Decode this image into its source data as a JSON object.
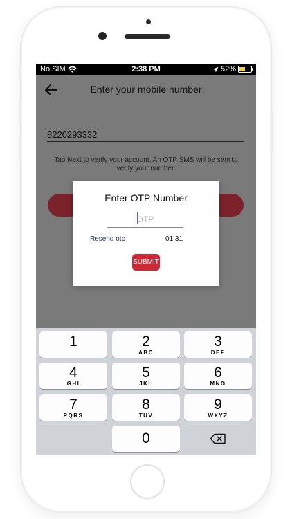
{
  "status_bar": {
    "carrier": "No SIM",
    "time": "2:38 PM",
    "battery": "52%",
    "battery_level": 0.52
  },
  "header": {
    "title": "Enter your mobile number"
  },
  "phone_input": {
    "value": "8220293332"
  },
  "hint_text": "Tap Next to verify your account. An OTP SMS will be sent to verify your number.",
  "dialog": {
    "title": "Enter OTP Number",
    "otp_placeholder": "OTP",
    "resend_label": "Resend otp",
    "timer": "01:31",
    "submit_label": "SUBMIT"
  },
  "keyboard": {
    "keys": [
      {
        "num": "1",
        "letters": ""
      },
      {
        "num": "2",
        "letters": "ABC"
      },
      {
        "num": "3",
        "letters": "DEF"
      },
      {
        "num": "4",
        "letters": "GHI"
      },
      {
        "num": "5",
        "letters": "JKL"
      },
      {
        "num": "6",
        "letters": "MNO"
      },
      {
        "num": "7",
        "letters": "PQRS"
      },
      {
        "num": "8",
        "letters": "TUV"
      },
      {
        "num": "9",
        "letters": "WXYZ"
      },
      {
        "num": "0",
        "letters": ""
      }
    ]
  },
  "colors": {
    "accent": "#cc2936",
    "overlay_button": "#7c222b",
    "battery_fill": "#f3d23b"
  }
}
